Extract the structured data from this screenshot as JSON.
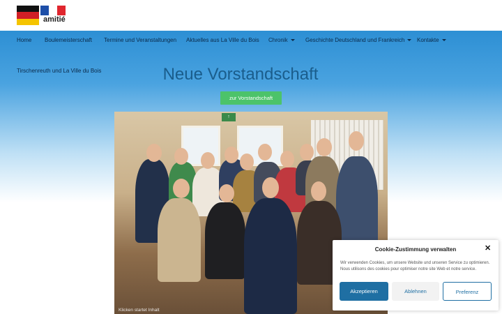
{
  "logo": {
    "text": "amitié"
  },
  "nav": {
    "items": [
      {
        "label": "Home",
        "dropdown": false
      },
      {
        "label": "Boulemeisterschaft",
        "dropdown": false
      },
      {
        "label": "Termine und Veranstaltungen",
        "dropdown": false
      },
      {
        "label": "Aktuelles aus La Ville du Bois",
        "dropdown": false
      },
      {
        "label": "Chronik",
        "dropdown": true
      },
      {
        "label": "Geschichte Deutschland und Frankreich",
        "dropdown": true
      },
      {
        "label": "Kontakte",
        "dropdown": true
      }
    ],
    "second_row": "Tirschenreuth und La Ville du Bois"
  },
  "main": {
    "title": "Neue Vorstandschaft",
    "button_label": "zur Vorstandschaft",
    "photo_caption": "Klicken startet Inhalt"
  },
  "cookie": {
    "title": "Cookie-Zustimmung verwalten",
    "text": "Wir verwenden Cookies, um unsere Website und unseren Service zu optimieren. Nous utilisons des cookies pour optimiser notre site Web et notre service.",
    "accept": "Akzeptieren",
    "deny": "Ablehnen",
    "preferences": "Preferenz"
  },
  "colors": {
    "nav_band": "#2d8fd4",
    "title": "#1a5d8c",
    "green_button": "#4cc36a",
    "accept_button": "#1f6fa3"
  }
}
